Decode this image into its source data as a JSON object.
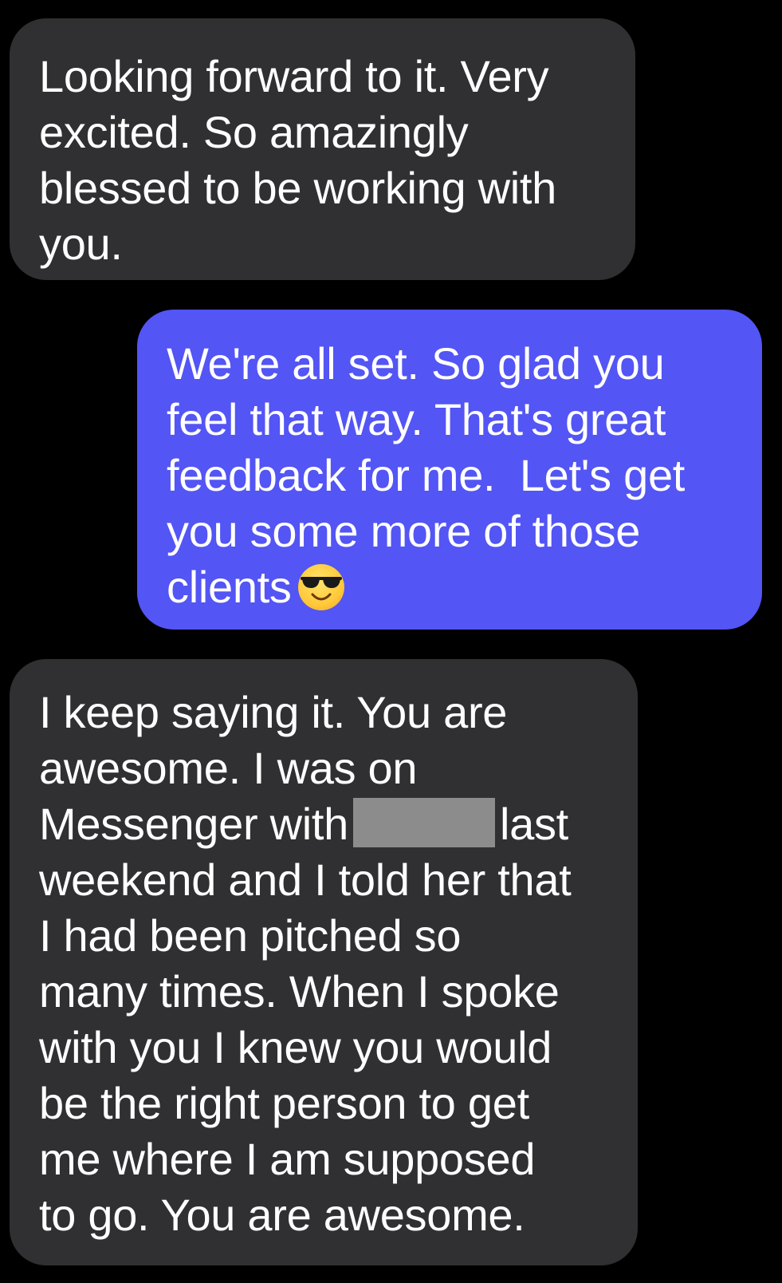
{
  "messages": [
    {
      "direction": "incoming",
      "lines": [
        "Looking forward to it. Very",
        "excited. So amazingly",
        "blessed to be working with",
        "you."
      ]
    },
    {
      "direction": "outgoing",
      "lines": [
        "We're all set. So glad you",
        "feel that way. That's great",
        "feedback for me.  Let's get",
        "you some more of those",
        "clients"
      ],
      "trailing_emoji": "smiling-face-with-sunglasses"
    },
    {
      "direction": "incoming",
      "lines": [
        "I keep saying it. You are",
        "awesome. I was on",
        "Messenger with",
        "last",
        "weekend and I told her that",
        "I had been pitched so",
        "many times. When I spoke",
        "with you I knew you would",
        "be the right person to get",
        "me where I am supposed",
        "to go. You are awesome."
      ],
      "redaction_after": "Messenger with"
    }
  ],
  "colors": {
    "background": "#000000",
    "incoming_bubble": "#303032",
    "outgoing_bubble": "#5355f4",
    "text": "#ffffff",
    "redaction": "#8c8c8c"
  }
}
